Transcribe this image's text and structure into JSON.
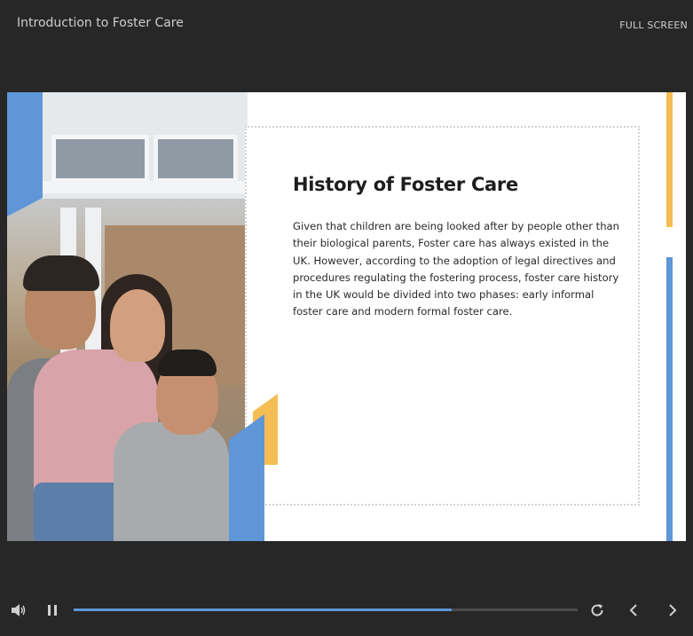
{
  "header": {
    "course_title": "Introduction to Foster Care",
    "fullscreen_label": "FULL SCREEN"
  },
  "slide": {
    "title": "History of Foster Care",
    "body": "Given that children are being looked after by people other than their biological parents, Foster care has always existed in the UK. However, according to the adoption of legal directives and procedures regulating the fostering process, foster care history in the UK would be divided into two phases: early informal foster care and modern formal foster care."
  },
  "player": {
    "progress": 0.75,
    "icons": [
      "volume-icon",
      "pause-icon",
      "replay-icon",
      "chevron-left-icon",
      "chevron-right-icon"
    ]
  },
  "colors": {
    "background": "#272727",
    "accent_blue": "#5e96d8",
    "accent_yellow": "#f5bd53"
  }
}
